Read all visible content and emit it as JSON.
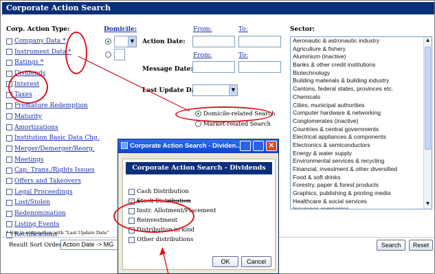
{
  "window": {
    "title": "Corporate Action Search"
  },
  "headers": {
    "corp_action_types": "Corp. Action Type:",
    "domicile": "Domicile:",
    "from": "From:",
    "to": "To:",
    "sector": "Sector:"
  },
  "action_types": [
    "Company Data *",
    "Instrument Data *",
    "Ratings *",
    "Dividends",
    "Interest",
    "Taxes",
    "Premature Redemption",
    "Maturity",
    "Amortizations",
    "Institution Basic Data Chg.",
    "Merger/Demerger/Reorg.",
    "Meetings",
    "Cap. Trans./Rights Issues",
    "Offers and Takeovers",
    "Legal Proceedings",
    "Lost/Stolen",
    "Redenomination",
    "Listing Events",
    "Rectifications"
  ],
  "footnote": "* Use in conjunction with \"Last Update Date\"",
  "fields": {
    "action_date": "Action Date:",
    "message_date": "Message Date:",
    "last_update_date": "Last Update Date:"
  },
  "search_mode": {
    "domicile_related": "Domicile-related Search",
    "market_related": "Market-related Search"
  },
  "sectors": [
    "Aeronautic & astronautic industry",
    "Agriculture & fishery",
    "Aluminium (inactive)",
    "Banks & other credit institutions",
    "Biotechnology",
    "Building materials & building industry",
    "Cantons, federal states, provinces etc.",
    "Chemicals",
    "Cities, municipal authorities",
    "Computer hardware & networking",
    "Conglomerates (inactive)",
    "Countries & central governments",
    "Electrical appliances & components",
    "Electronics & semiconductors",
    "Energy & water supply",
    "Environmental services & recycling",
    "Financial, investment & other diversified",
    "Food & soft drinks",
    "Forestry, paper & forest products",
    "Graphics, publishing & printing media",
    "Healthcare & social services",
    "Insurance companies"
  ],
  "sort": {
    "label": "Result Sort Order:",
    "value": "Action Date -> MG"
  },
  "buttons": {
    "search": "Search",
    "reset": "Reset"
  },
  "dialog": {
    "title": "Corporate Action Search - Dividen...",
    "header": "Corporate Action Search - Dividends",
    "options": [
      {
        "label": "Cash Distribution",
        "checked": false
      },
      {
        "label": "Stock Distribution",
        "checked": true
      },
      {
        "label": "Instr. Allotment/Placement",
        "checked": false
      },
      {
        "label": "Reinvestment",
        "checked": false
      },
      {
        "label": "Distribution in kind",
        "checked": false
      },
      {
        "label": "Other distributions",
        "checked": false
      }
    ],
    "ok": "OK",
    "cancel": "Cancel"
  },
  "colors": {
    "header_bg": "#0c2f7a",
    "annotation": "#e0101a",
    "link": "#1a2fa8"
  }
}
